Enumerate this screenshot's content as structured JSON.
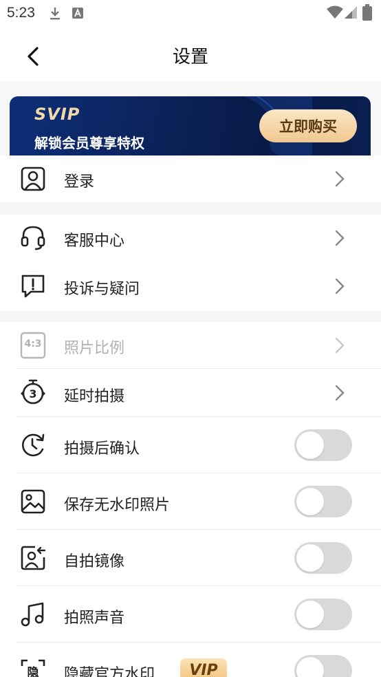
{
  "status_bar": {
    "time": "5:23",
    "icons": [
      "download-icon",
      "a-notification-icon",
      "wifi-icon",
      "signal-icon",
      "battery-icon"
    ]
  },
  "header": {
    "title": "设置",
    "back_icon": "chevron-left-icon"
  },
  "vip_banner": {
    "badge": "SVIP",
    "subtitle": "解锁会员尊享特权",
    "buy_label": "立即购买",
    "colors": {
      "background": "#0b2257",
      "badge": "#f2d9a8",
      "button": "#f0c88f"
    }
  },
  "account": {
    "login_label": "登录",
    "login_icon": "user-portrait-icon"
  },
  "support": {
    "items": [
      {
        "label": "客服中心",
        "icon": "headset-icon"
      },
      {
        "label": "投诉与疑问",
        "icon": "feedback-icon"
      }
    ]
  },
  "camera_settings": {
    "nav_items": [
      {
        "label": "照片比例",
        "icon": "aspect-ratio-icon",
        "ratio_text": "4:3",
        "disabled": true
      },
      {
        "label": "延时拍摄",
        "icon": "timer-3-icon",
        "disabled": false
      }
    ],
    "toggle_items": [
      {
        "label": "拍摄后确认",
        "icon": "clock-refresh-icon",
        "on": false
      },
      {
        "label": "保存无水印照片",
        "icon": "image-icon",
        "on": false
      },
      {
        "label": "自拍镜像",
        "icon": "selfie-mirror-icon",
        "on": false
      },
      {
        "label": "拍照声音",
        "icon": "music-note-icon",
        "on": false
      },
      {
        "label": "隐藏官方水印",
        "icon": "hide-watermark-icon",
        "on": false,
        "tag": "VIP"
      }
    ]
  }
}
